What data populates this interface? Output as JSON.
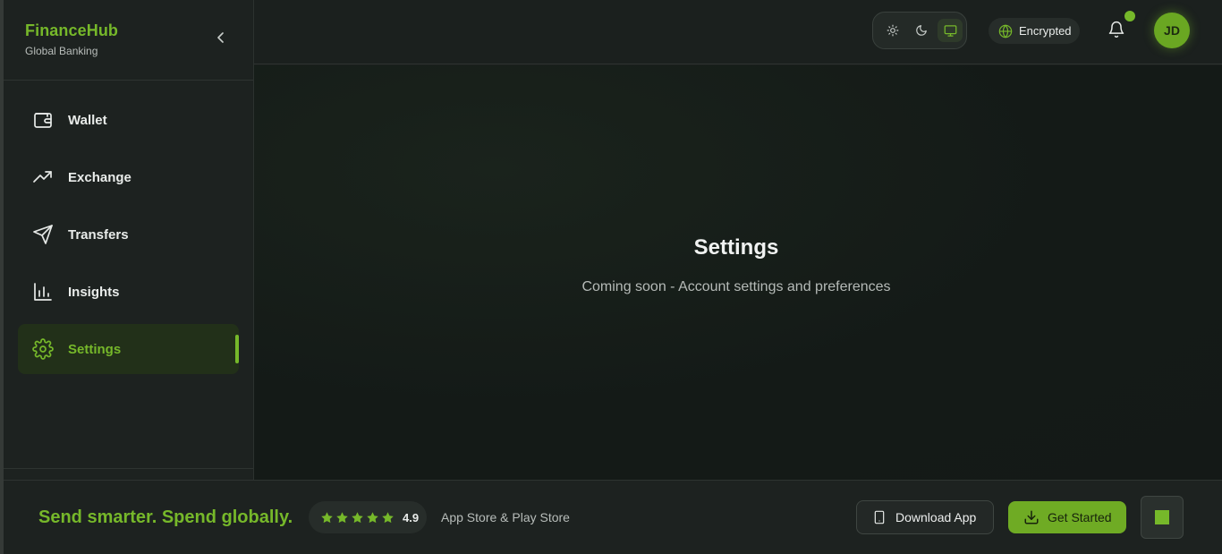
{
  "brand": {
    "title": "FinanceHub",
    "subtitle": "Global Banking"
  },
  "sidebar": {
    "items": [
      {
        "label": "Wallet",
        "icon": "wallet-icon",
        "active": false
      },
      {
        "label": "Exchange",
        "icon": "trending-up-icon",
        "active": false
      },
      {
        "label": "Transfers",
        "icon": "send-icon",
        "active": false
      },
      {
        "label": "Insights",
        "icon": "bar-chart-icon",
        "active": false
      },
      {
        "label": "Settings",
        "icon": "gear-icon",
        "active": true
      }
    ]
  },
  "header": {
    "theme_options": [
      "sun-icon",
      "moon-icon",
      "monitor-icon"
    ],
    "theme_selected": "monitor-icon",
    "status_label": "Encrypted",
    "avatar_initials": "JD"
  },
  "main": {
    "title": "Settings",
    "subtitle": "Coming soon - Account settings and preferences"
  },
  "footer": {
    "tagline": "Send smarter. Spend globally.",
    "rating": "4.9",
    "rating_stars": 5,
    "store_text": "App Store & Play Store",
    "download_label": "Download App",
    "get_started_label": "Get Started"
  },
  "colors": {
    "accent": "#76b82a",
    "background": "#141a17",
    "sidebar": "#1d2220"
  }
}
